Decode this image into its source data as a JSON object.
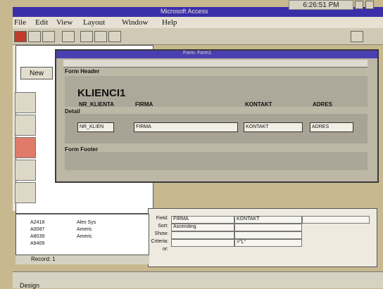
{
  "app": {
    "title": "Microsoft Access",
    "clock": "6:26:51 PM"
  },
  "menu": [
    "File",
    "Edit",
    "View",
    "Layout",
    "Window",
    "Help"
  ],
  "database_window": {
    "new_button": "New"
  },
  "form_window": {
    "title": "Form: Form1",
    "sections": {
      "header": "Form Header",
      "detail": "Detail",
      "footer": "Form Footer"
    },
    "header_title": "KLIENCI1",
    "column_headers": [
      "NR_KLIENTA",
      "FIRMA",
      "KONTAKT",
      "ADRES"
    ],
    "fields": [
      "NR_KLIEN",
      "FIRMA",
      "KONTAKT",
      "ADRES"
    ]
  },
  "query_grid": {
    "row_labels": [
      "Field:",
      "Sort:",
      "Show:",
      "Criteria:",
      "or:"
    ],
    "fields": [
      "FIRMA",
      "KONTAKT"
    ],
    "sort_value": "Ascending",
    "criteria": ">\"L\""
  },
  "datasheet": {
    "rows": [
      {
        "id": "A2418",
        "name": "Alex Sys"
      },
      {
        "id": "A0087",
        "name": "Americ"
      },
      {
        "id": "A8039",
        "name": "Americ"
      },
      {
        "id": "A9409",
        "name": ""
      }
    ],
    "record_label": "Record: 1"
  },
  "status": {
    "text": "Design"
  }
}
